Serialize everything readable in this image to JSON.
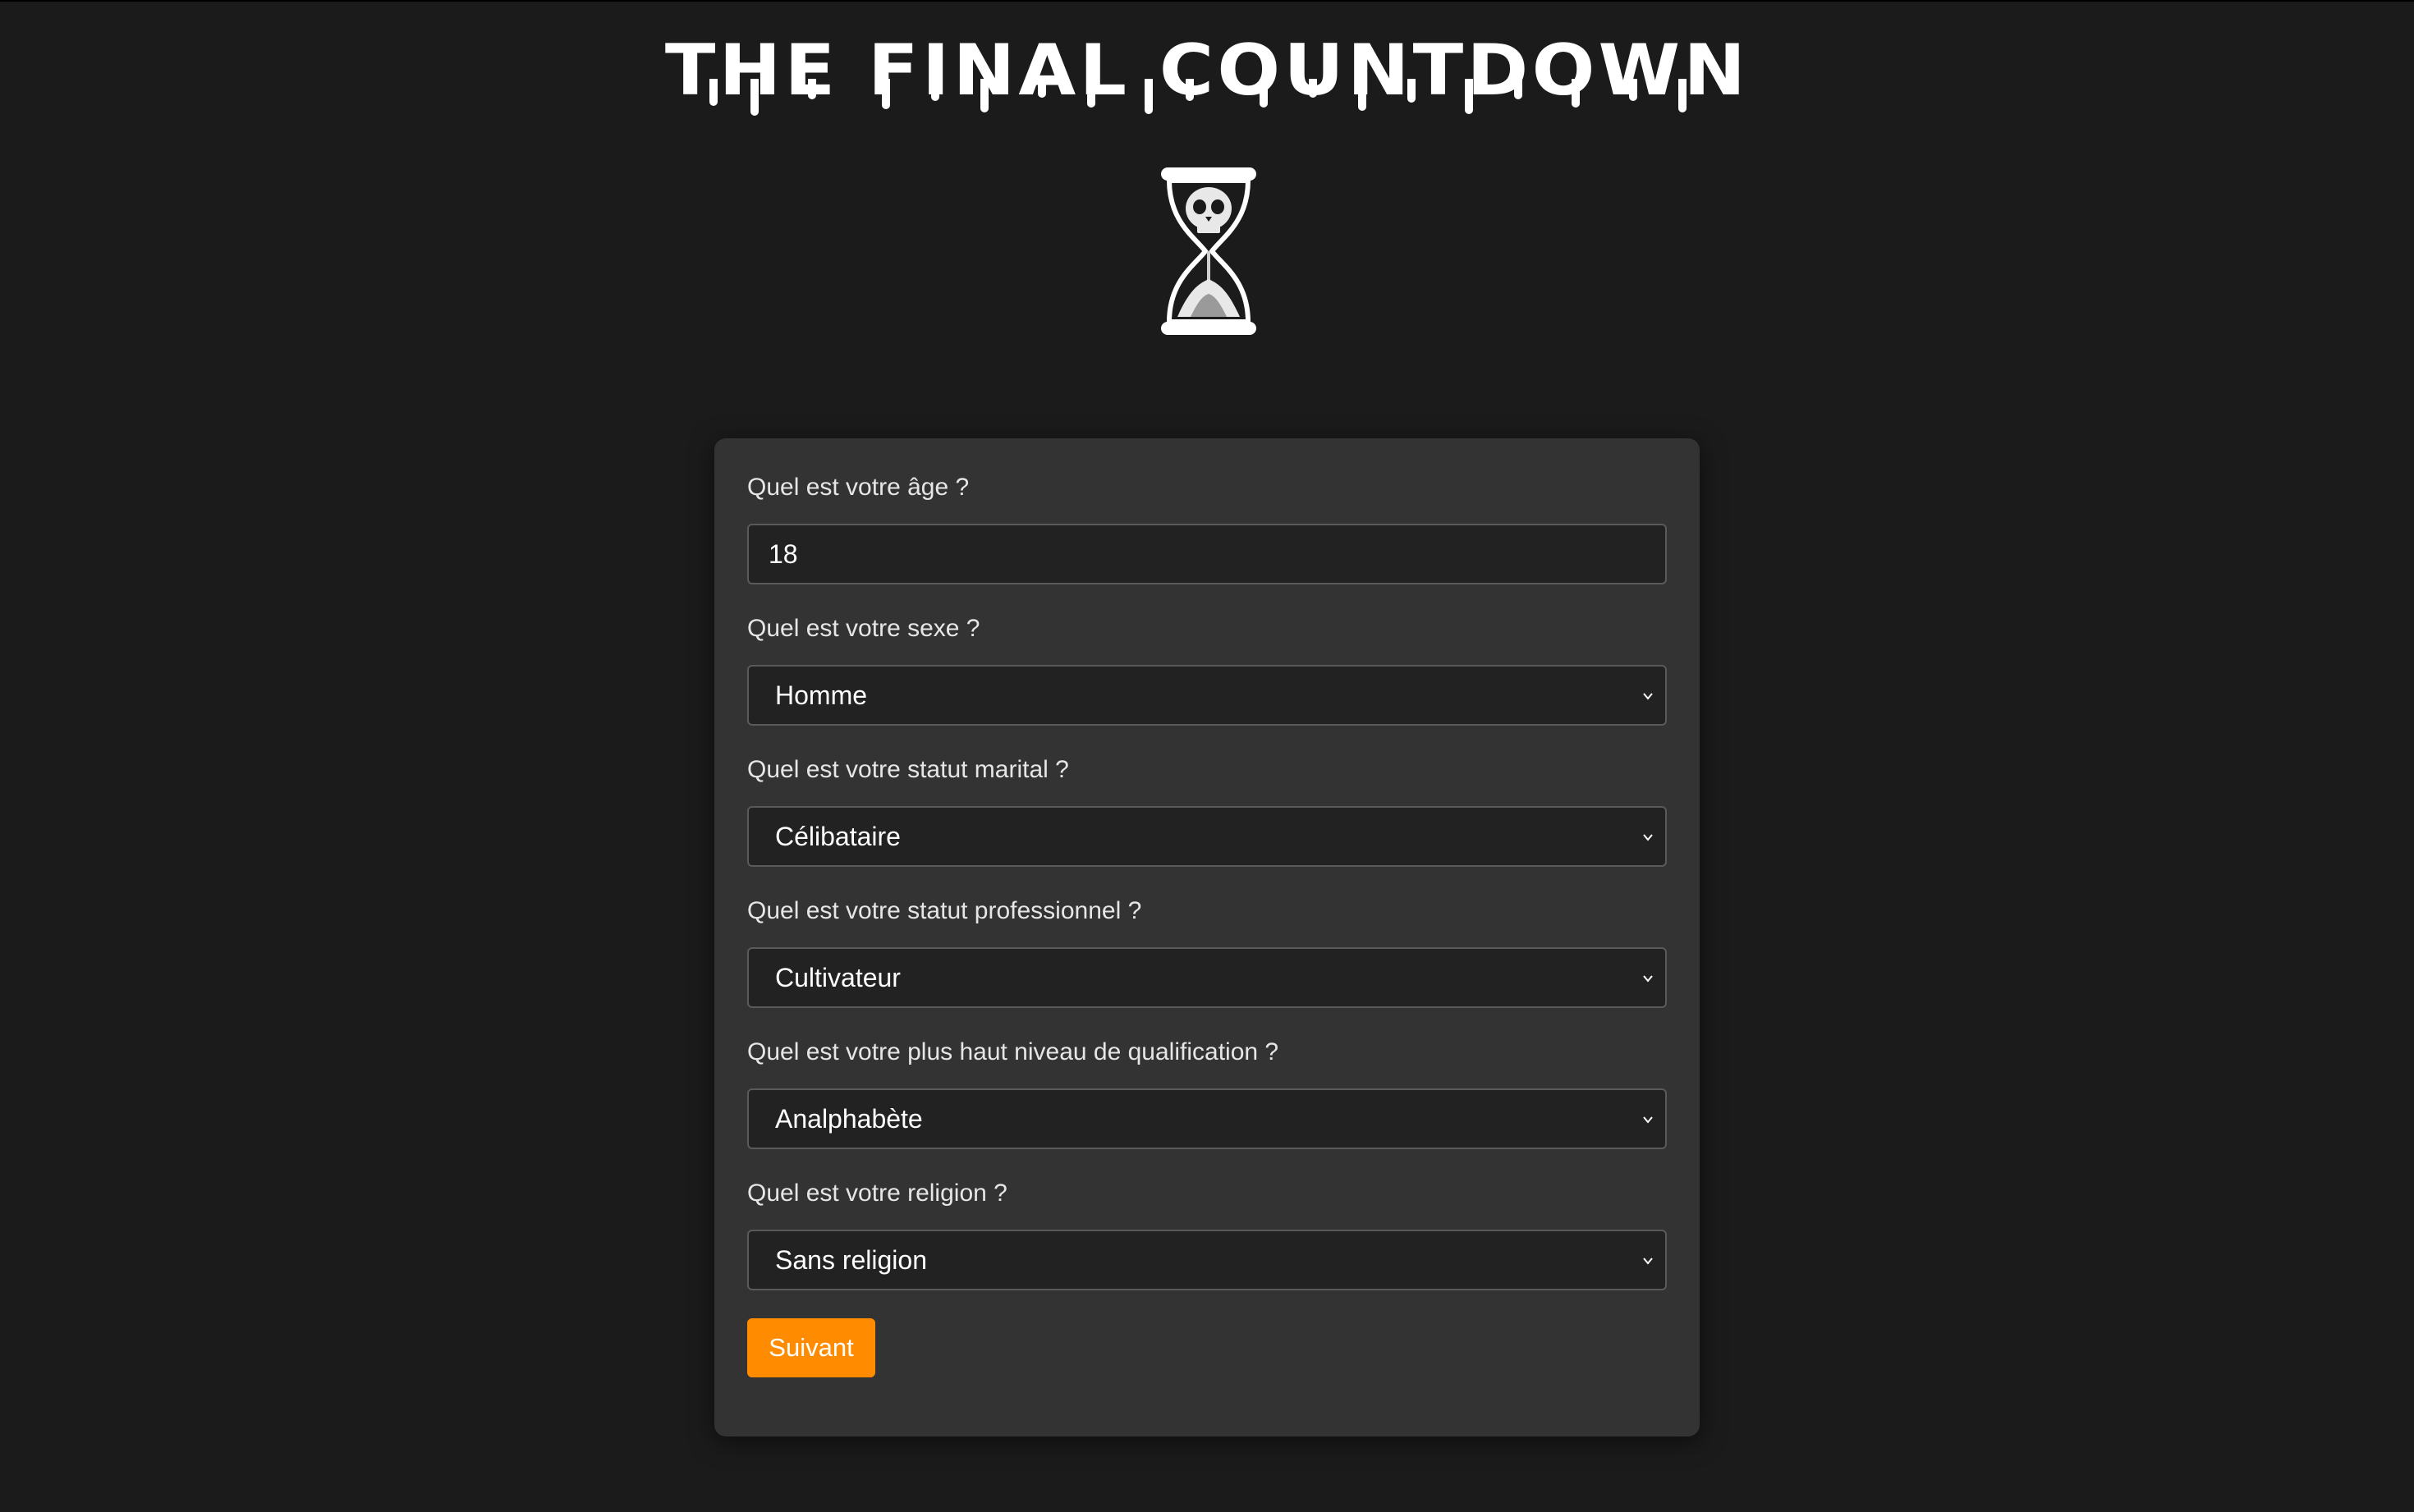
{
  "header": {
    "title": "THE FINAL COUNTDOWN",
    "logo_icon": "hourglass-skull-icon"
  },
  "form": {
    "fields": [
      {
        "label": "Quel est votre âge ?",
        "type": "input",
        "value": "18"
      },
      {
        "label": "Quel est votre sexe ?",
        "type": "select",
        "value": "Homme"
      },
      {
        "label": "Quel est votre statut marital ?",
        "type": "select",
        "value": "Célibataire"
      },
      {
        "label": "Quel est votre statut professionnel ?",
        "type": "select",
        "value": "Cultivateur"
      },
      {
        "label": "Quel est votre plus haut niveau de qualification ?",
        "type": "select",
        "value": "Analphabète"
      },
      {
        "label": "Quel est votre religion ?",
        "type": "select",
        "value": "Sans religion"
      }
    ],
    "submit_label": "Suivant"
  },
  "colors": {
    "background": "#1b1b1b",
    "card": "#333333",
    "accent": "#ff8c00"
  }
}
